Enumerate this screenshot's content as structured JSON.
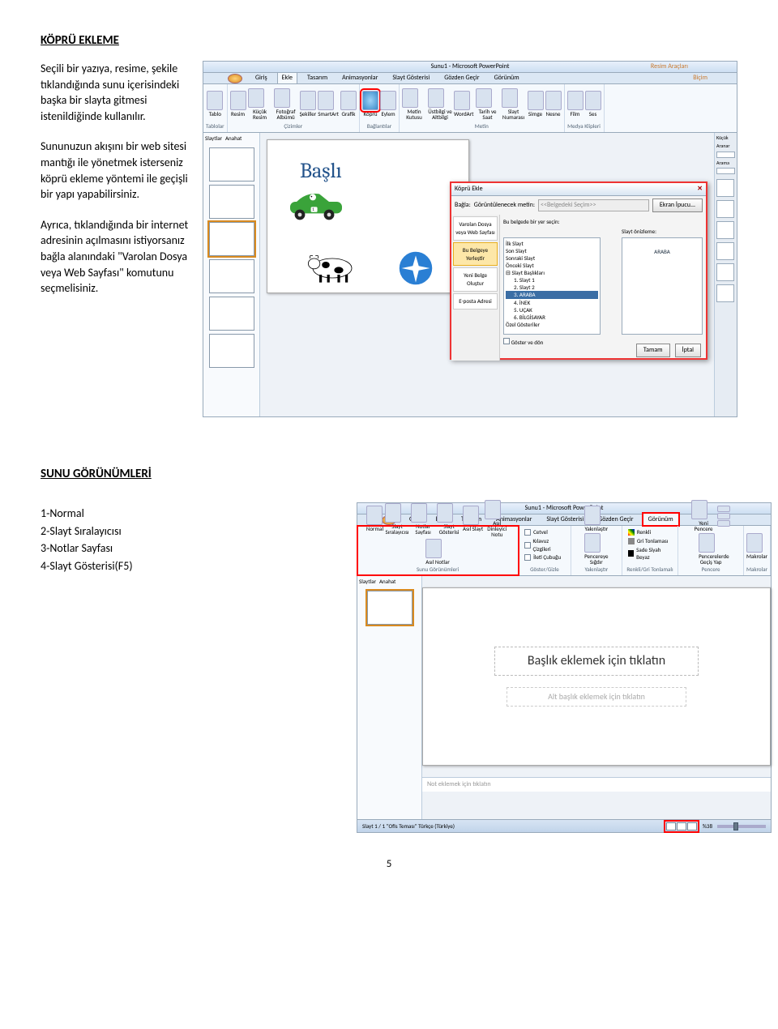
{
  "heading1": "KÖPRÜ EKLEME",
  "para1": "Seçili bir yazıya, resime, şekile tıklandığında sunu içerisindeki başka bir slayta gitmesi istenildiğinde kullanılır.",
  "para2": "Sununuzun akışını bir web sitesi mantığı ile yönetmek isterseniz köprü ekleme yöntemi ile geçişli bir yapı yapabilirsiniz.",
  "para3": "Ayrıca, tıklandığında bir internet adresinin açılmasını istiyorsanız bağla alanındaki \"Varolan Dosya veya Web Sayfası\" komutunu seçmelisiniz.",
  "heading2": "SUNU GÖRÜNÜMLERİ",
  "list": {
    "i1": "1-Normal",
    "i2": "2-Slayt Sıralayıcısı",
    "i3": "3-Notlar Sayfası",
    "i4": "4-Slayt Gösterisi(F5)"
  },
  "page_no": "5",
  "ss1": {
    "window_title": "Sunu1 - Microsoft PowerPoint",
    "ctx_tab": "Resim Araçları",
    "ctx_sub": "Biçim",
    "tabs": [
      "Giriş",
      "Ekle",
      "Tasarım",
      "Animasyonlar",
      "Slayt Gösterisi",
      "Gözden Geçir",
      "Görünüm"
    ],
    "active_tab": "Ekle",
    "groups": {
      "tablolar": "Tablolar",
      "cizimler": "Çizimler",
      "baglantilar": "Bağlantılar",
      "metin": "Metin",
      "medya": "Medya Klipleri"
    },
    "icons": {
      "tablo": "Tablo",
      "resim": "Resim",
      "kucuk_resim": "Küçük Resim",
      "fotograf_albumu": "Fotoğraf Albümü",
      "sekiller": "Şekiller",
      "smartart": "SmartArt",
      "grafik": "Grafik",
      "kopru": "Köprü",
      "eylem": "Eylem",
      "metin_kutusu": "Metin Kutusu",
      "ustbilgi": "Üstbilgi ve Altbilgi",
      "wordart": "WordArt",
      "tarih_saat": "Tarih ve Saat",
      "slayt_no": "Slayt Numarası",
      "simge": "Simge",
      "nesne": "Nesne",
      "film": "Film",
      "ses": "Ses"
    },
    "thumb_tabs": {
      "slaytlar": "Slaytlar",
      "anahat": "Anahat"
    },
    "thumbs": [
      "1",
      "2",
      "3",
      "4",
      "5",
      "6"
    ],
    "slide_title": "Başlı",
    "task_title": "Küçük",
    "task_search_label": "Aranar",
    "task_search2": "Arama",
    "dialog": {
      "title": "Köprü Ekle",
      "bagla": "Bağla:",
      "goruntu": "Görüntülenecek metin:",
      "goruntu_val": "<<Belgedeki Seçim>>",
      "ekran_ipucu": "Ekran İpucu...",
      "nav": {
        "varolan": "Varolan Dosya veya Web Sayfası",
        "bubelge": "Bu Belgeye Yerleştir",
        "yeni": "Yeni Belge Oluştur",
        "eposta": "E-posta Adresi"
      },
      "tree_label": "Bu belgede bir yer seçin:",
      "preview_label": "Slayt önizleme:",
      "preview_text": "ARABA",
      "tree": [
        "İlk Slayt",
        "Son Slayt",
        "Sonraki Slayt",
        "Önceki Slayt",
        "Slayt Başlıkları",
        "1. Slayt 1",
        "2. Slayt 2",
        "3. ARABA",
        "4. İNEK",
        "5. UÇAK",
        "6. BİLGİSAYAR",
        "Özel Gösteriler"
      ],
      "goster": "Göster ve dön",
      "tamam": "Tamam",
      "iptal": "İptal"
    }
  },
  "ss2": {
    "window_title": "Sunu1 - Microsoft PowerPoint",
    "tabs": [
      "Giriş",
      "Ekle",
      "Tasarım",
      "Animasyonlar",
      "Slayt Gösterisi",
      "Gözden Geçir",
      "Görünüm"
    ],
    "active_tab": "Görünüm",
    "groups": {
      "sunu": "Sunu Görünümleri",
      "goster": "Göster/Gizle",
      "yakin": "Yakınlaştır",
      "renk": "Renkli/Gri Tonlamalı",
      "pencere": "Pencere",
      "makro": "Makrolar"
    },
    "icons": {
      "normal": "Normal",
      "siralayici": "Slayt Sıralayıcısı",
      "notlar": "Notlar Sayfası",
      "gosterisi": "Slayt Gösterisi",
      "asil_slayt": "Asıl Slayt",
      "asil_dinleyici": "Asıl Dinleyici Notu",
      "asil_notlar": "Asıl Notlar",
      "yakinlastir": "Yakınlaştır",
      "sigdir": "Pencereye Sığdır",
      "yeni_pencere": "Yeni Pencere",
      "gecis": "Pencerelerde Geçiş Yap",
      "makrolar": "Makrolar"
    },
    "checks": {
      "cetvel": "Cetvel",
      "kilavuz": "Kılavuz Çizgileri",
      "ileti": "İleti Çubuğu"
    },
    "color_opts": {
      "renkli": "Renkli",
      "gri": "Gri Tonlaması",
      "siyah": "Sade Siyah Beyaz"
    },
    "thumb_tabs": {
      "slaytlar": "Slaytlar",
      "anahat": "Anahat"
    },
    "ph_title": "Başlık eklemek için tıklatın",
    "ph_sub": "Alt başlık eklemek için tıklatın",
    "notes": "Not eklemek için tıklatın",
    "status_left": "Slayt 1 / 1    \"Ofis Teması\"    Türkçe (Türkiye)",
    "status_zoom": "%38"
  }
}
